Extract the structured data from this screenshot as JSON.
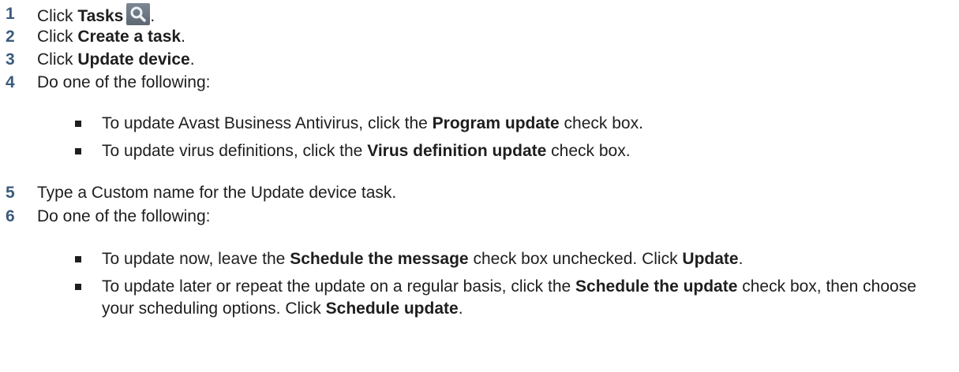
{
  "steps": [
    {
      "num": "1",
      "pre": "Click ",
      "bold": "Tasks",
      "post": "."
    },
    {
      "num": "2",
      "pre": "Click ",
      "bold": "Create a task",
      "post": "."
    },
    {
      "num": "3",
      "pre": "Click ",
      "bold": "Update device",
      "post": "."
    },
    {
      "num": "4",
      "text": "Do one of the following:"
    },
    {
      "num": "5",
      "text": "Type a Custom name for the Update device task."
    },
    {
      "num": "6",
      "text": "Do one of the following:"
    }
  ],
  "bullets_a": [
    {
      "pre": "To update Avast Business Antivirus, click the ",
      "bold": "Program update",
      "post": " check box."
    },
    {
      "pre": "To update virus definitions, click the ",
      "bold": "Virus definition update",
      "post": " check box."
    }
  ],
  "bullets_b": [
    {
      "pre": "To update now, leave the ",
      "bold": "Schedule the message",
      "mid": " check box unchecked. Click ",
      "bold2": "Update",
      "post": "."
    },
    {
      "pre": "To update later or repeat the update on a regular basis, click the ",
      "bold": "Schedule the update",
      "mid": " check box, then choose your scheduling options. Click ",
      "bold2": "Schedule update",
      "post": "."
    }
  ],
  "icons": {
    "tasks": "search-icon"
  },
  "colors": {
    "step_number": "#3b5b7c",
    "text": "#1e1e1e"
  }
}
